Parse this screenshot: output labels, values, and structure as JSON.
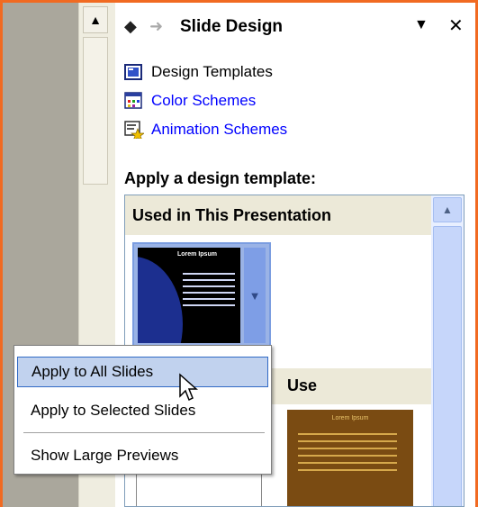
{
  "pane": {
    "title": "Slide Design",
    "links": [
      {
        "label": "Design Templates",
        "icon": "design-templates-icon"
      },
      {
        "label": "Color Schemes",
        "icon": "color-schemes-icon"
      },
      {
        "label": "Animation Schemes",
        "icon": "animation-schemes-icon"
      }
    ],
    "apply_label": "Apply a design template:"
  },
  "gallery": {
    "section1": "Used in This Presentation",
    "section2": "Use",
    "thumb1_title": "Lorem Ipsum",
    "thumb3_title": "Lorem Ipsum"
  },
  "context_menu": {
    "items": [
      "Apply to All Slides",
      "Apply to Selected Slides",
      "Show Large Previews"
    ]
  },
  "colors": {
    "frame": "#f16a21",
    "link": "#0000ff",
    "highlight": "#c1d2ee"
  }
}
